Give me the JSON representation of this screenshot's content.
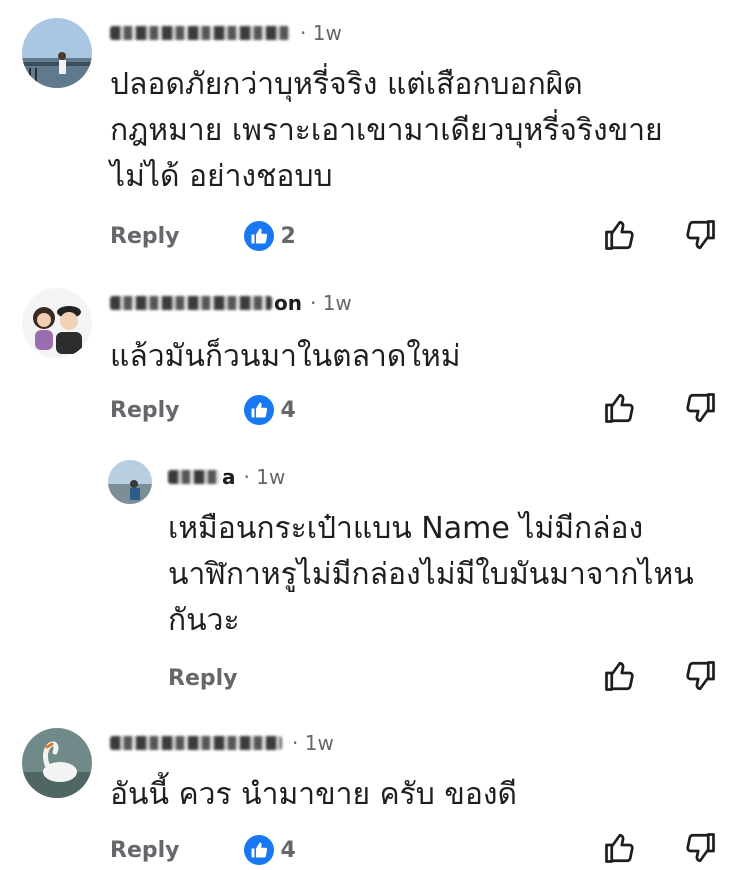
{
  "comments": [
    {
      "name_suffix": "",
      "time": "1w",
      "text": "ปลอดภัยกว่าบุหรี่จริง แต่เสือกบอกผิด\nกฎหมาย เพราะเอาเขามาเดียวบุหรี่จริงขาย\nไม่ได้ อย่างชอบบ",
      "reply_label": "Reply",
      "likes": "2"
    },
    {
      "name_suffix": "on",
      "time": "1w",
      "text": "แล้วมันก็วนมาในตลาดใหม่",
      "reply_label": "Reply",
      "likes": "4"
    },
    {
      "name_suffix": "a",
      "time": "1w",
      "text": "เหมือนกระเป๋าแบน Name ไม่มีกล่อง\nนาฬิกาหรูไม่มีกล่องไม่มีใบมันมาจากไหน\nกันวะ",
      "reply_label": "Reply",
      "likes": ""
    },
    {
      "name_suffix": "",
      "time": "1w",
      "text": "อันนี้ ควร นำมาขาย ครับ ของดี",
      "reply_label": "Reply",
      "likes": "4"
    }
  ],
  "separator": "·",
  "icons": {
    "like_badge": "thumbs-up-icon",
    "like": "like-icon",
    "dislike": "dislike-icon"
  },
  "colors": {
    "like_blue": "#1877f2",
    "secondary_text": "#65676b"
  }
}
